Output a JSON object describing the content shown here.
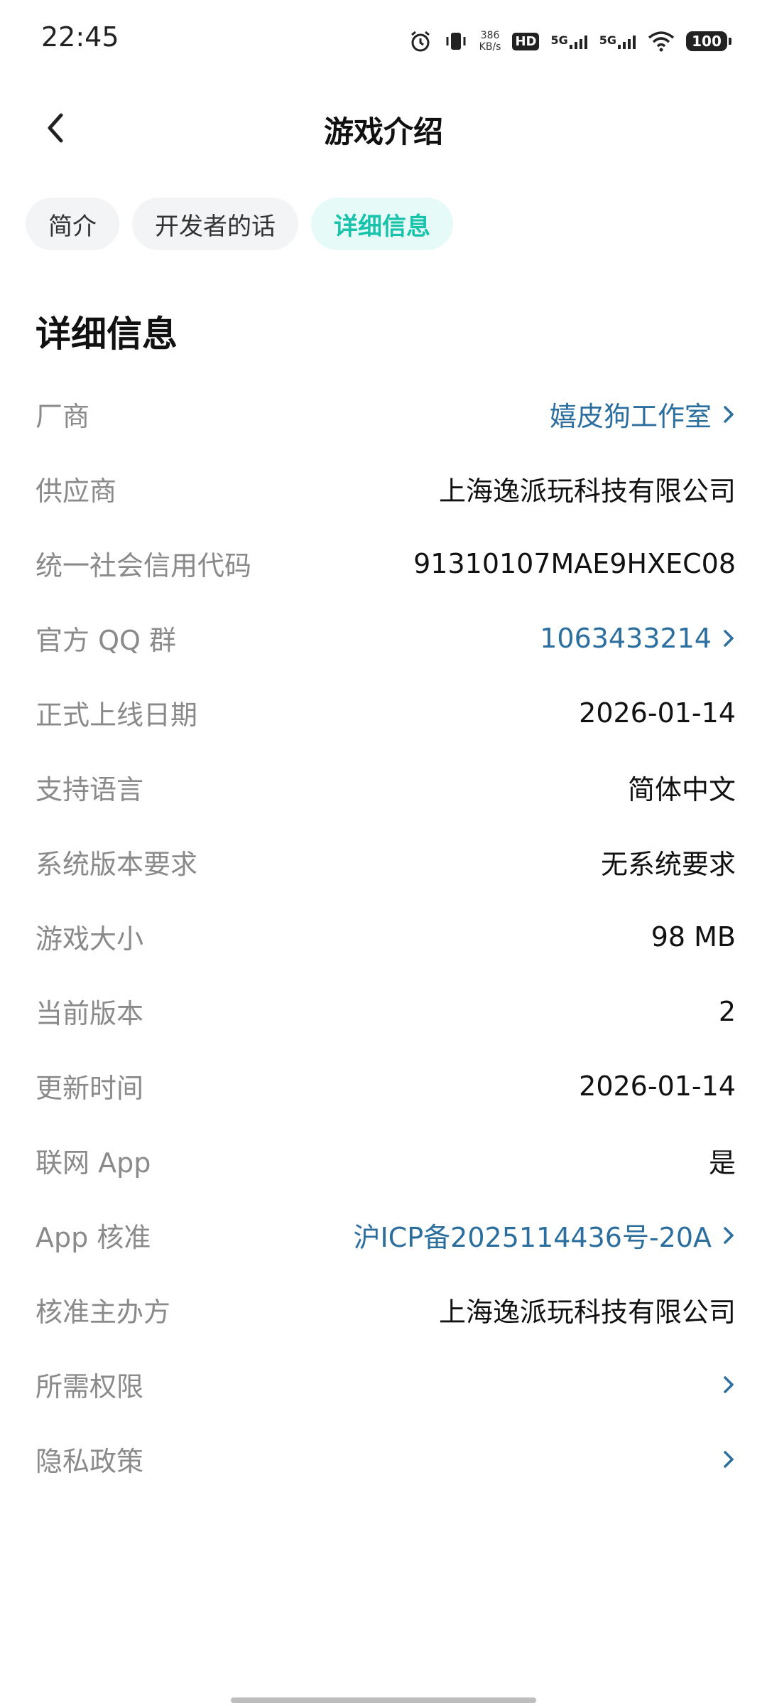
{
  "status_bar": {
    "time": "22:45",
    "net_speed_value": "386",
    "net_speed_unit": "KB/s",
    "hd_label": "HD",
    "signal_1": "5G",
    "signal_2": "5G",
    "battery": "100"
  },
  "header": {
    "title": "游戏介绍"
  },
  "tabs": [
    {
      "label": "简介",
      "active": false
    },
    {
      "label": "开发者的话",
      "active": false
    },
    {
      "label": "详细信息",
      "active": true
    }
  ],
  "section": {
    "title": "详细信息"
  },
  "rows": [
    {
      "label": "厂商",
      "value": "嬉皮狗工作室",
      "link": true
    },
    {
      "label": "供应商",
      "value": "上海逸派玩科技有限公司",
      "link": false
    },
    {
      "label": "统一社会信用代码",
      "value": "91310107MAE9HXEC08",
      "link": false
    },
    {
      "label": "官方 QQ 群",
      "value": "1063433214",
      "link": true
    },
    {
      "label": "正式上线日期",
      "value": "2026-01-14",
      "link": false
    },
    {
      "label": "支持语言",
      "value": "简体中文",
      "link": false
    },
    {
      "label": "系统版本要求",
      "value": "无系统要求",
      "link": false
    },
    {
      "label": "游戏大小",
      "value": "98 MB",
      "link": false
    },
    {
      "label": "当前版本",
      "value": "2",
      "link": false
    },
    {
      "label": "更新时间",
      "value": "2026-01-14",
      "link": false
    },
    {
      "label": "联网 App",
      "value": "是",
      "link": false
    },
    {
      "label": "App 核准",
      "value": "沪ICP备2025114436号-20A",
      "link": true
    },
    {
      "label": "核准主办方",
      "value": "上海逸派玩科技有限公司",
      "link": false
    },
    {
      "label": "所需权限",
      "value": "",
      "link": true
    },
    {
      "label": "隐私政策",
      "value": "",
      "link": true
    }
  ],
  "colors": {
    "accent": "#19c2aa",
    "link": "#2c6f9e",
    "label": "#8a8a8a"
  }
}
